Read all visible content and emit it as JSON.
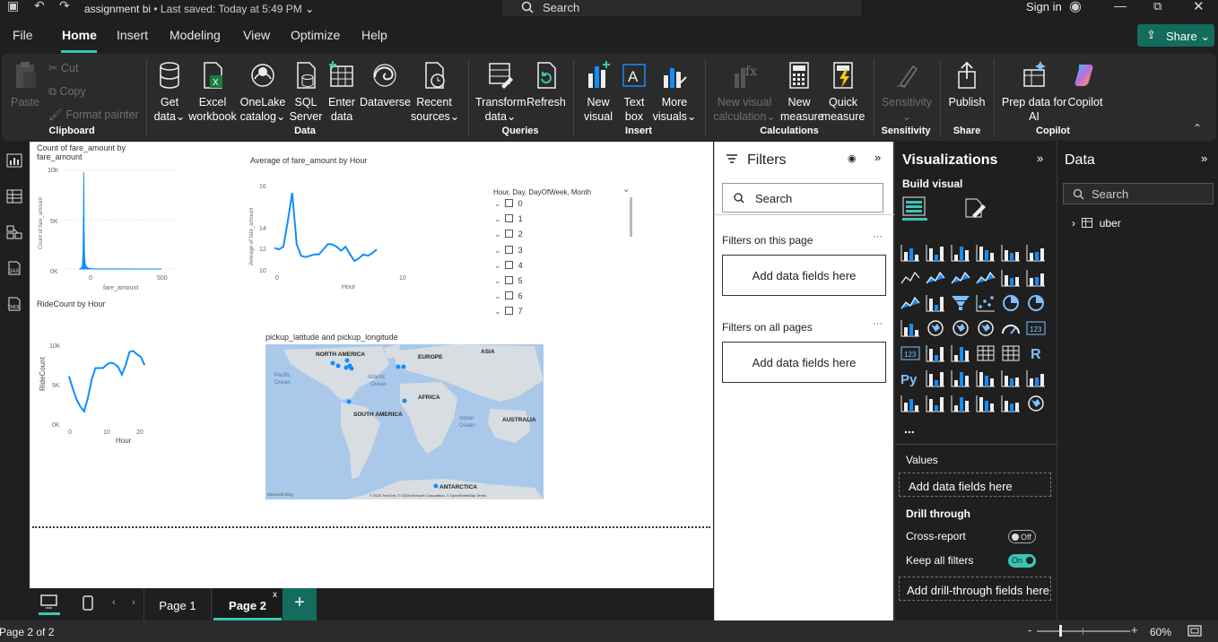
{
  "titlebar": {
    "title": "assignment bi",
    "saved": "• Last saved: Today at 5:49 PM",
    "search": "Search",
    "signin": "Sign in"
  },
  "menu": [
    "File",
    "Home",
    "Insert",
    "Modeling",
    "View",
    "Optimize",
    "Help"
  ],
  "share": "Share",
  "ribbon": {
    "clipboard": {
      "paste": "Paste",
      "cut": "Cut",
      "copy": "Copy",
      "format_painter": "Format painter",
      "label": "Clipboard"
    },
    "data": {
      "get_data": [
        "Get",
        "data"
      ],
      "excel": [
        "Excel",
        "workbook"
      ],
      "onelake": [
        "OneLake",
        "catalog"
      ],
      "sql": [
        "SQL",
        "Server"
      ],
      "enter": [
        "Enter",
        "data"
      ],
      "dataverse": "Dataverse",
      "recent": [
        "Recent",
        "sources"
      ],
      "label": "Data"
    },
    "queries": {
      "transform": [
        "Transform",
        "data"
      ],
      "refresh": "Refresh",
      "label": "Queries"
    },
    "insert": {
      "new_visual": [
        "New",
        "visual"
      ],
      "text_box": [
        "Text",
        "box"
      ],
      "more_visuals": [
        "More",
        "visuals"
      ],
      "label": "Insert"
    },
    "calculations": {
      "new_visual_calc": [
        "New visual",
        "calculation"
      ],
      "new_measure": [
        "New",
        "measure"
      ],
      "quick_measure": [
        "Quick",
        "measure"
      ],
      "label": "Calculations"
    },
    "sensitivity": {
      "sensitivity": "Sensitivity",
      "label": "Sensitivity"
    },
    "share": {
      "publish": "Publish",
      "label": "Share"
    },
    "copilot": {
      "prep": [
        "Prep data for",
        "AI"
      ],
      "copilot": "Copilot",
      "label": "Copilot"
    }
  },
  "canvas": {
    "chart1": {
      "title": [
        "Count of fare_amount by",
        "fare_amount"
      ],
      "ylabel": "Count of fare_amount",
      "xlabel": "fare_amount",
      "yticks": [
        "10K",
        "5K",
        "0K"
      ],
      "xticks": [
        "0",
        "500"
      ]
    },
    "chart2": {
      "title": "Average of fare_amount by Hour",
      "ylabel": "Average of fare_amount",
      "xlabel": "Hour",
      "yticks": [
        "16",
        "14",
        "12",
        "10"
      ],
      "xticks": [
        "0",
        "10",
        "20"
      ]
    },
    "chart3": {
      "title": "RideCount by Hour",
      "ylabel": "RideCount",
      "xlabel": "Hour",
      "yticks": [
        "10K",
        "5K",
        "0K"
      ],
      "xticks": [
        "0",
        "10",
        "20"
      ]
    },
    "slicer": {
      "header": "Hour, Day, DayOfWeek, Month",
      "items": [
        "0",
        "1",
        "2",
        "3",
        "4",
        "5",
        "6",
        "7"
      ]
    },
    "map": {
      "title": "pickup_latitude and pickup_longitude",
      "labels": {
        "na": "NORTH AMERICA",
        "eu": "EUROPE",
        "as": "ASIA",
        "af": "AFRICA",
        "sa": "SOUTH AMERICA",
        "au": "AUSTRALIA",
        "an": "ANTARCTICA",
        "po": [
          "Pacific",
          "Ocean"
        ],
        "ao": [
          "Atlantic",
          "Ocean"
        ],
        "io": [
          "Indian",
          "Ocean"
        ]
      },
      "credit": "© 2025 TomTom, © 2025 Microsoft Corporation, © OpenStreetMap  Terms",
      "bing": "Microsoft Bing"
    }
  },
  "chart_data": [
    {
      "type": "area",
      "title": "Count of fare_amount by fare_amount",
      "xlabel": "fare_amount",
      "ylabel": "Count of fare_amount",
      "x": [
        -20,
        -5,
        0,
        3,
        5,
        7,
        9,
        12,
        15,
        20,
        30,
        50,
        100,
        500
      ],
      "values": [
        0,
        200,
        1500,
        6000,
        9800,
        4000,
        2000,
        900,
        500,
        300,
        120,
        40,
        10,
        0
      ],
      "ylim": [
        0,
        10000
      ],
      "xlim": [
        -100,
        550
      ]
    },
    {
      "type": "line",
      "title": "Average of fare_amount by Hour",
      "xlabel": "Hour",
      "ylabel": "Average of fare_amount",
      "x": [
        0,
        1,
        2,
        3,
        4,
        5,
        6,
        7,
        8,
        9,
        10,
        11,
        12,
        13,
        14,
        15,
        16,
        17,
        18,
        19,
        20,
        21,
        22,
        23
      ],
      "values": [
        11.7,
        11.6,
        11.8,
        13.8,
        16.0,
        12.0,
        11.1,
        11.0,
        11.1,
        11.2,
        11.2,
        11.6,
        12.0,
        12.0,
        11.8,
        11.5,
        11.8,
        11.2,
        10.7,
        10.9,
        11.2,
        11.1,
        11.3,
        11.6
      ],
      "ylim": [
        10,
        16.5
      ]
    },
    {
      "type": "line",
      "title": "RideCount by Hour",
      "xlabel": "Hour",
      "ylabel": "RideCount",
      "x": [
        0,
        1,
        2,
        3,
        4,
        5,
        6,
        7,
        8,
        9,
        10,
        11,
        12,
        13,
        14,
        15,
        16,
        17,
        18,
        19,
        20,
        21,
        22,
        23
      ],
      "values": [
        7900,
        5800,
        4000,
        2800,
        2000,
        4300,
        7400,
        9300,
        9300,
        9300,
        9900,
        10200,
        10000,
        9500,
        8200,
        9800,
        12000,
        12200,
        11600,
        11200,
        9800
      ],
      "ylim": [
        0,
        13000
      ]
    }
  ],
  "filters": {
    "title": "Filters",
    "search": "Search",
    "on_page": "Filters on this page",
    "all_pages": "Filters on all pages",
    "add": "Add data fields here"
  },
  "viz": {
    "title": "Visualizations",
    "build": "Build visual",
    "values": "Values",
    "add_values": "Add data fields here",
    "drill": "Drill through",
    "cross": "Cross-report",
    "off": "Off",
    "keep": "Keep all filters",
    "on": "On",
    "add_drill": "Add drill-through fields here",
    "more": "..."
  },
  "data_pane": {
    "title": "Data",
    "search": "Search",
    "table": "uber"
  },
  "pages": {
    "p1": "Page 1",
    "p2": "Page 2",
    "add": "+"
  },
  "status": {
    "page": "Page 2 of 2",
    "zoom": "60%"
  },
  "colors": {
    "accent": "#118dff",
    "teal": "#136c5e",
    "line": "#118dff"
  }
}
